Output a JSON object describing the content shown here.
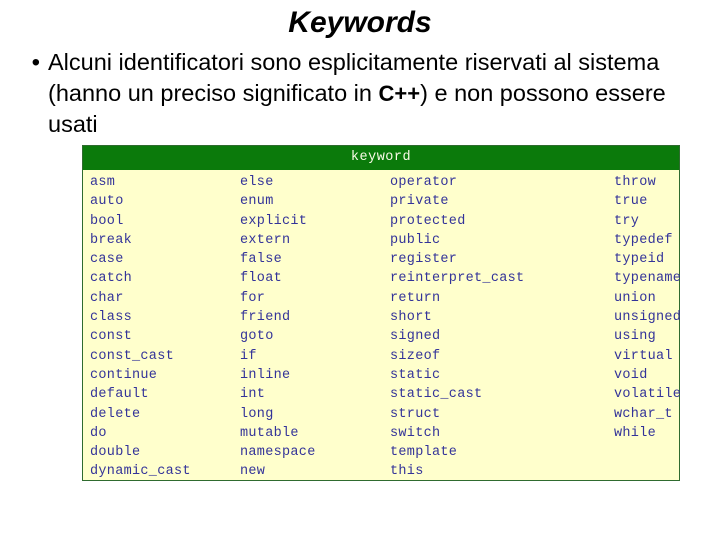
{
  "slide": {
    "title": "Keywords",
    "bullet_marker": "•",
    "body_part_1": "Alcuni identificatori sono esplicitamente riservati al sistema (hanno un preciso significato in ",
    "body_code": "C++",
    "body_part_2": ") e non possono essere usati"
  },
  "table": {
    "header": "keyword",
    "header_bg": "#0b7a0b",
    "header_text_color": "#fbfbe8",
    "body_bg": "#ffffcc",
    "text_color": "#333399",
    "border_color": "#2f6b2f",
    "columns": [
      {
        "items": [
          "asm",
          "auto",
          "bool",
          "break",
          "case",
          "catch",
          "char",
          "class",
          "const",
          "const_cast",
          "continue",
          "default",
          "delete",
          "do",
          "double",
          "dynamic_cast"
        ]
      },
      {
        "items": [
          "else",
          "enum",
          "explicit",
          "extern",
          "false",
          "float",
          "for",
          "friend",
          "goto",
          "if",
          "inline",
          "int",
          "long",
          "mutable",
          "namespace",
          "new"
        ]
      },
      {
        "items": [
          "operator",
          "private",
          "protected",
          "public",
          "register",
          "reinterpret_cast",
          "return",
          "short",
          "signed",
          "sizeof",
          "static",
          "static_cast",
          "struct",
          "switch",
          "template",
          "this"
        ]
      },
      {
        "items": [
          "throw",
          "true",
          "try",
          "typedef",
          "typeid",
          "typename",
          "union",
          "unsigned",
          "using",
          "virtual",
          "void",
          "volatile",
          "wchar_t",
          "while"
        ]
      }
    ]
  }
}
